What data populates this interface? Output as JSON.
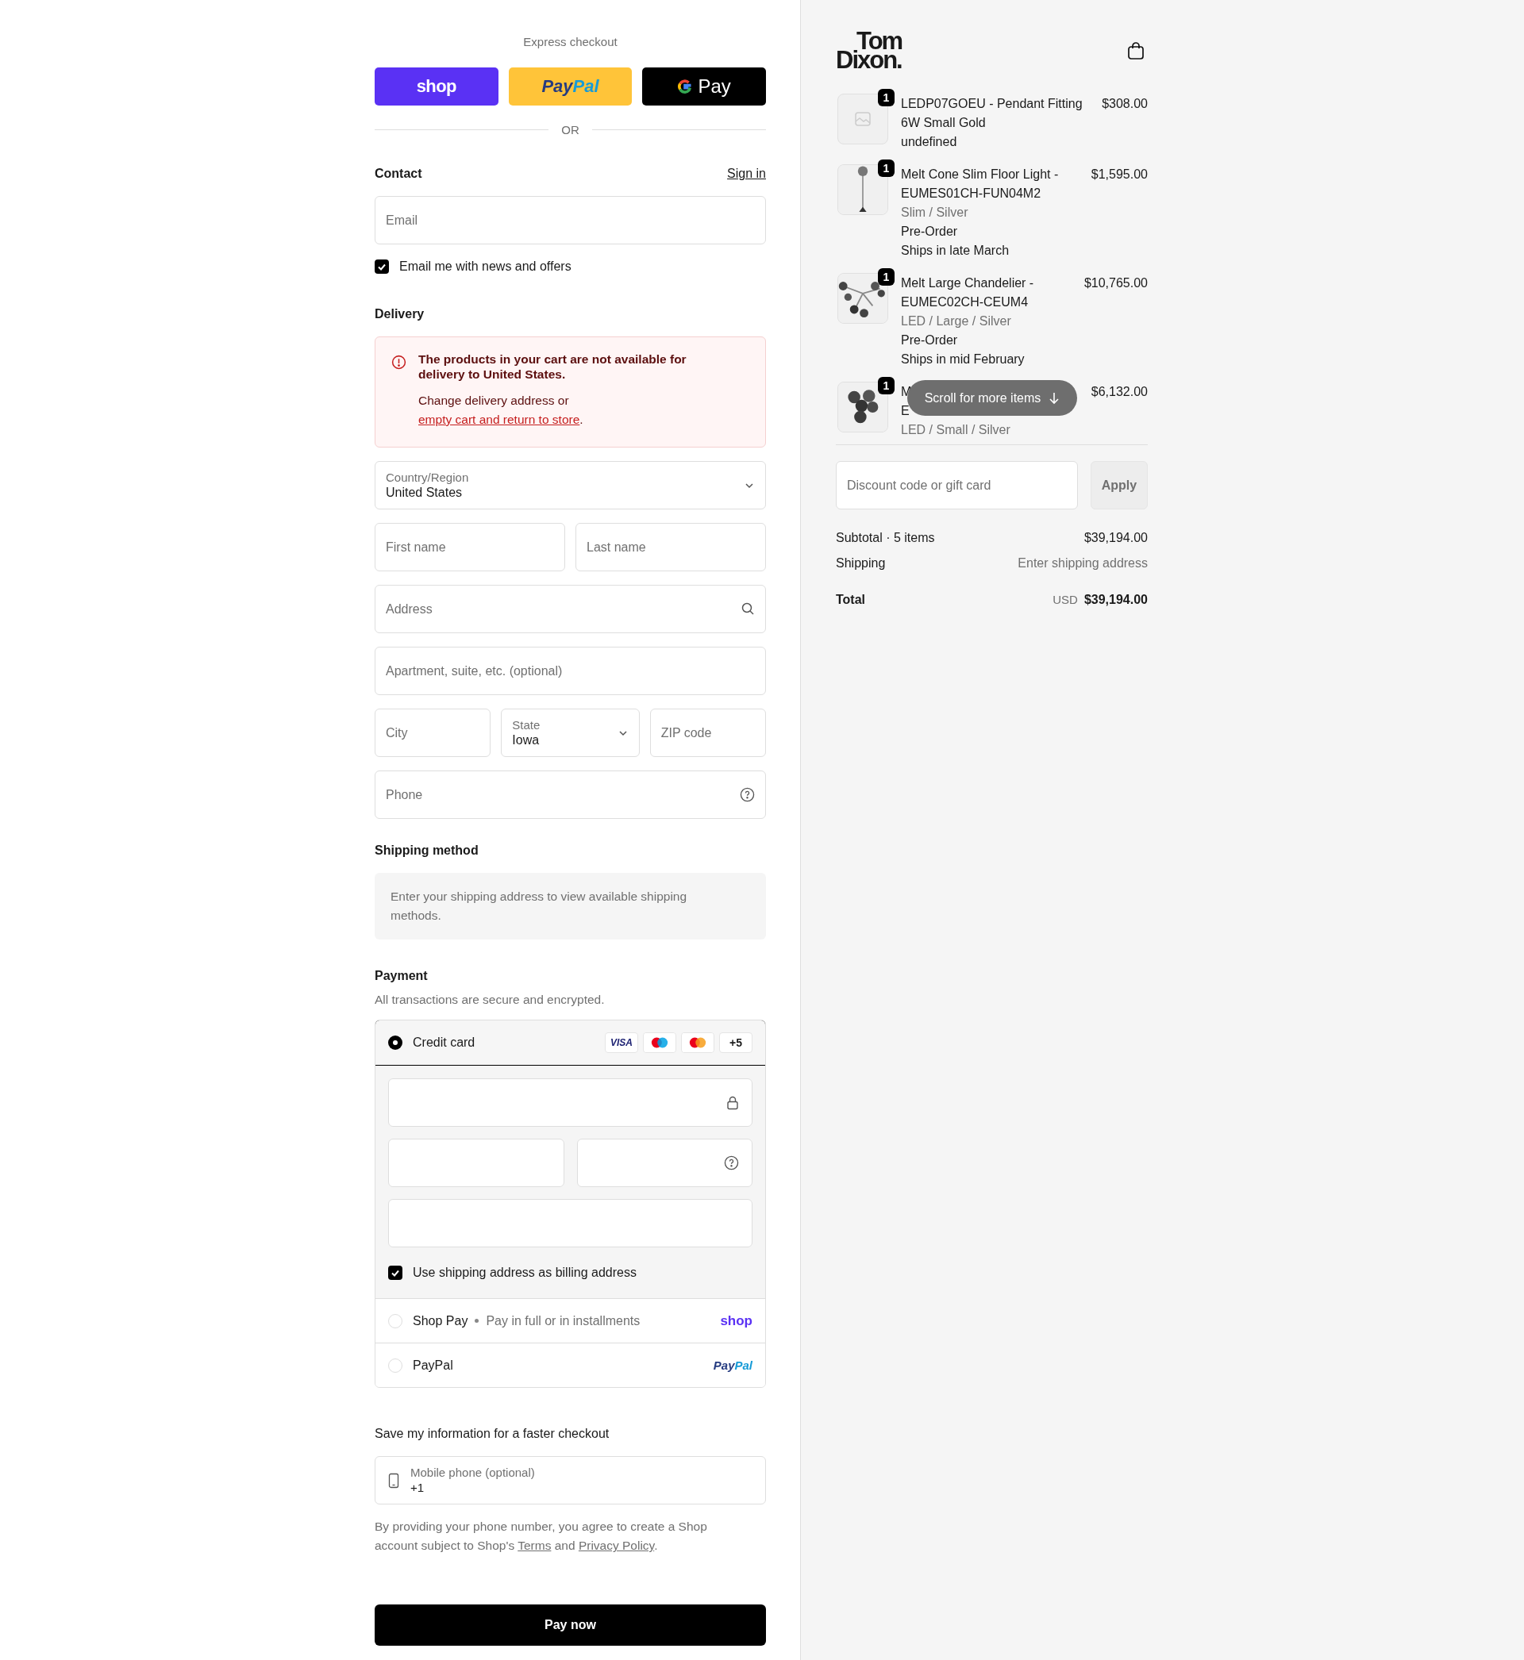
{
  "express_checkout": {
    "title": "Express checkout",
    "buttons": [
      {
        "kind": "shop",
        "label": "shop"
      },
      {
        "kind": "paypal",
        "label_1": "Pay",
        "label_2": "Pal"
      },
      {
        "kind": "gpay",
        "label": "Pay"
      }
    ],
    "divider": "OR"
  },
  "contact": {
    "title": "Contact",
    "sign_in": "Sign in",
    "email": {
      "placeholder": "Email"
    },
    "newsletter": {
      "label": "Email me with news and offers",
      "checked": true
    }
  },
  "delivery": {
    "title": "Delivery",
    "alert": {
      "title": "The products in your cart are not available for delivery to United States.",
      "message": "Change delivery address or",
      "link": "empty cart and return to store",
      "end": "."
    },
    "rows": [
      [
        {
          "kind": "select",
          "label": "Country/Region",
          "value": "United States"
        }
      ],
      [
        {
          "kind": "text",
          "placeholder": "First name"
        },
        {
          "kind": "text",
          "placeholder": "Last name"
        }
      ],
      [
        {
          "kind": "search",
          "placeholder": "Address"
        }
      ],
      [
        {
          "kind": "text",
          "placeholder": "Apartment, suite, etc. (optional)"
        }
      ],
      [
        {
          "kind": "text",
          "placeholder": "City"
        },
        {
          "kind": "select",
          "label": "State",
          "value": "Iowa"
        },
        {
          "kind": "text",
          "placeholder": "ZIP code"
        }
      ],
      [
        {
          "kind": "help",
          "placeholder": "Phone"
        }
      ]
    ]
  },
  "shipping_method": {
    "title": "Shipping method",
    "message": "Enter your shipping address to view available shipping methods."
  },
  "payment": {
    "title": "Payment",
    "subtitle": "All transactions are secure and encrypted.",
    "methods": [
      {
        "kind": "card",
        "label": "Credit card",
        "selected": true,
        "brands": [
          {
            "kind": "visa",
            "label": "VISA"
          },
          {
            "kind": "maestro"
          },
          {
            "kind": "mastercard"
          },
          {
            "kind": "more",
            "label": "+5"
          }
        ],
        "billing": {
          "label": "Use shipping address as billing address",
          "checked": true
        }
      },
      {
        "kind": "shoppay",
        "label": "Shop Pay",
        "detail": "Pay in full or in installments",
        "logo": "shop",
        "selected": false
      },
      {
        "kind": "paypal",
        "label": "PayPal",
        "logo_1": "Pay",
        "logo_2": "Pal",
        "selected": false
      }
    ]
  },
  "save_info": {
    "title": "Save my information for a faster checkout",
    "phone": {
      "label": "Mobile phone (optional)",
      "value": "+1"
    },
    "disclaimer": {
      "before": "By providing your phone number, you agree to create a Shop account subject to Shop's ",
      "terms": "Terms",
      "middle": " and ",
      "privacy": "Privacy Policy",
      "after": "."
    }
  },
  "pay_button": "Pay now",
  "summary": {
    "logo": [
      "Tom",
      "Dixon."
    ],
    "items": [
      {
        "quantity": "1",
        "name": "LEDP07GOEU - Pendant Fitting 6W Small Gold",
        "price": "$308.00",
        "image": {
          "kind": "placeholder"
        },
        "lines": [
          {
            "kind": "plain",
            "text": "undefined"
          }
        ]
      },
      {
        "quantity": "1",
        "name": "Melt Cone Slim Floor Light - EUMES01CH-FUN04M2",
        "price": "$1,595.00",
        "image": {
          "kind": "floor"
        },
        "lines": [
          {
            "kind": "variant",
            "text": "Slim / Silver"
          },
          {
            "kind": "plain",
            "text": "Pre-Order"
          },
          {
            "kind": "plain",
            "text": "Ships in late March"
          }
        ]
      },
      {
        "quantity": "1",
        "name": "Melt Large Chandelier - EUMEC02CH-CEUM4",
        "price": "$10,765.00",
        "image": {
          "kind": "chandelier"
        },
        "lines": [
          {
            "kind": "variant",
            "text": "LED / Large / Silver"
          },
          {
            "kind": "plain",
            "text": "Pre-Order"
          },
          {
            "kind": "plain",
            "text": "Ships in mid February"
          }
        ]
      },
      {
        "quantity": "1",
        "name": "M\nE",
        "price": "$6,132.00",
        "image": {
          "kind": "cluster"
        },
        "lines": [
          {
            "kind": "variant",
            "text": "LED / Small / Silver"
          }
        ]
      }
    ],
    "scroll_hint": "Scroll for more items",
    "discount": {
      "placeholder": "Discount code or gift card",
      "button": "Apply"
    },
    "subtotal": {
      "label": "Subtotal · 5 items",
      "value": "$39,194.00"
    },
    "shipping": {
      "label": "Shipping",
      "value": "Enter shipping address"
    },
    "total": {
      "label": "Total",
      "currency": "USD",
      "value": "$39,194.00"
    }
  }
}
